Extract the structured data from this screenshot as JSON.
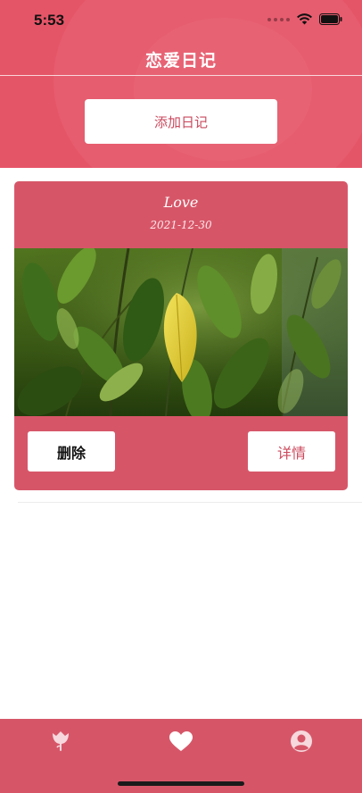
{
  "status_bar": {
    "time": "5:53"
  },
  "nav": {
    "title": "恋爱日记"
  },
  "actions": {
    "add_label": "添加日记"
  },
  "diary_entries": [
    {
      "title": "Love",
      "date": "2021-12-30",
      "photo": "green-leaves-photo",
      "delete_label": "删除",
      "detail_label": "详情"
    }
  ],
  "tab_bar": {
    "items": [
      {
        "icon": "rose-icon",
        "active": false
      },
      {
        "icon": "heart-icon",
        "active": true
      },
      {
        "icon": "user-icon",
        "active": false
      }
    ]
  },
  "colors": {
    "primary": "#e55568",
    "card": "#d65668",
    "accent_text": "#cc4a5d",
    "white": "#ffffff"
  }
}
